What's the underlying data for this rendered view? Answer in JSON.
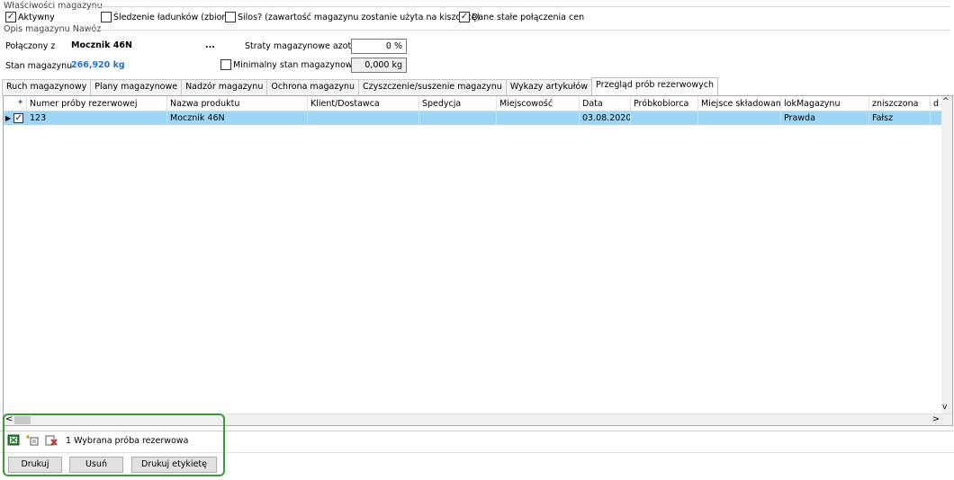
{
  "properties": {
    "group_title": "Właściwości magazynu",
    "active": {
      "label": "Aktywny",
      "checked": true
    },
    "tracking": {
      "label": "Śledzenie ładunków (zbiory)",
      "checked": false
    },
    "silo": {
      "label": "Silos? (zawartość magazynu zostanie użyta na kiszonkę)",
      "checked": false
    },
    "price_link": {
      "label": "Dane stałe połączenia cen",
      "checked": true
    }
  },
  "description": {
    "group_title": "Opis magazynu Nawóz",
    "connected_label": "Połączony z",
    "connected_value": "Mocznik 46N",
    "ellipsis": "...",
    "stock_label": "Stan magazynu",
    "stock_value": "266,920 kg",
    "loss_label": "Straty magazynowe azotu",
    "loss_value": "0 %",
    "min_stock_label": "Minimalny stan magazynowy",
    "min_stock_checked": false,
    "min_stock_value": "0,000 kg"
  },
  "tabs": [
    {
      "label": "Ruch magazynowy"
    },
    {
      "label": "Plany magazynowe"
    },
    {
      "label": "Nadzór magazynu"
    },
    {
      "label": "Ochrona magazynu"
    },
    {
      "label": "Czyszczenie/suszenie magazynu"
    },
    {
      "label": "Wykazy artykułów"
    },
    {
      "label": "Przegląd prób rezerwowych",
      "active": true
    }
  ],
  "grid": {
    "star": "*",
    "columns": [
      "Numer próby rezerwowej",
      "Nazwa produktu",
      "Klient/Dostawca",
      "Spedycja",
      "Miejscowość",
      "Data",
      "Próbkobiorca",
      "Miejsce składowania",
      "lokMagazynu",
      "zniszczona",
      "d"
    ],
    "rows": [
      {
        "checked": true,
        "cells": [
          "123",
          "Mocznik 46N",
          "",
          "",
          "",
          "03.08.2020",
          "",
          "",
          "Prawda",
          "Fałsz",
          ""
        ]
      }
    ]
  },
  "footer": {
    "selection_text": "1 Wybrana próba rezerwowa",
    "print_button": "Drukuj",
    "delete_button": "Usuń",
    "print_label_button": "Drukuj etykietę"
  }
}
